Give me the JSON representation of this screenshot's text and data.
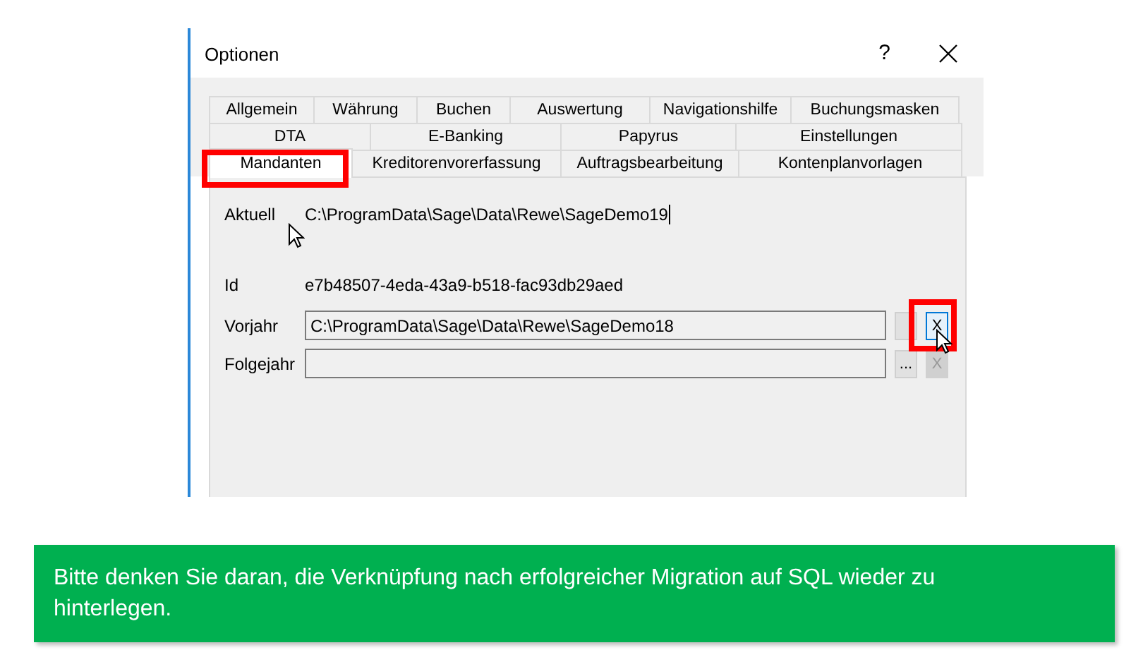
{
  "window": {
    "title": "Optionen",
    "help": "?"
  },
  "tab_rows": [
    [
      {
        "label": "Allgemein",
        "selected": false
      },
      {
        "label": "Währung",
        "selected": false
      },
      {
        "label": "Buchen",
        "selected": false
      },
      {
        "label": "Auswertung",
        "selected": false
      },
      {
        "label": "Navigationshilfe",
        "selected": false
      },
      {
        "label": "Buchungsmasken",
        "selected": false
      }
    ],
    [
      {
        "label": "DTA",
        "selected": false
      },
      {
        "label": "E-Banking",
        "selected": false
      },
      {
        "label": "Papyrus",
        "selected": false
      },
      {
        "label": "Einstellungen",
        "selected": false
      }
    ],
    [
      {
        "label": "Mandanten",
        "selected": true,
        "highlighted": true
      },
      {
        "label": "Kreditorenvorerfassung",
        "selected": false
      },
      {
        "label": "Auftragsbearbeitung",
        "selected": false
      },
      {
        "label": "Kontenplanvorlagen",
        "selected": false
      }
    ]
  ],
  "fields": [
    {
      "kind": "text",
      "label": "Aktuell",
      "value": "C:\\ProgramData\\Sage\\Data\\Rewe\\SageDemo19",
      "caret": true,
      "cursor": true
    },
    {
      "kind": "text",
      "label": "Id",
      "value": "e7b48507-4eda-43a9-b518-fac93db29aed"
    },
    {
      "kind": "input",
      "label": "Vorjahr",
      "value": "C:\\ProgramData\\Sage\\Data\\Rewe\\SageDemo18",
      "clear": {
        "label": "X",
        "disabled": false,
        "highlighted": true,
        "cursor": true
      }
    },
    {
      "kind": "input",
      "label": "Folgejahr",
      "browse": "...",
      "clear": {
        "label": "X",
        "disabled": true,
        "highlighted": false,
        "cursor": false
      }
    }
  ],
  "note": "Bitte denken Sie daran, die Verknüpfung nach erfolgreicher Migration auf SQL wieder zu hinterlegen."
}
